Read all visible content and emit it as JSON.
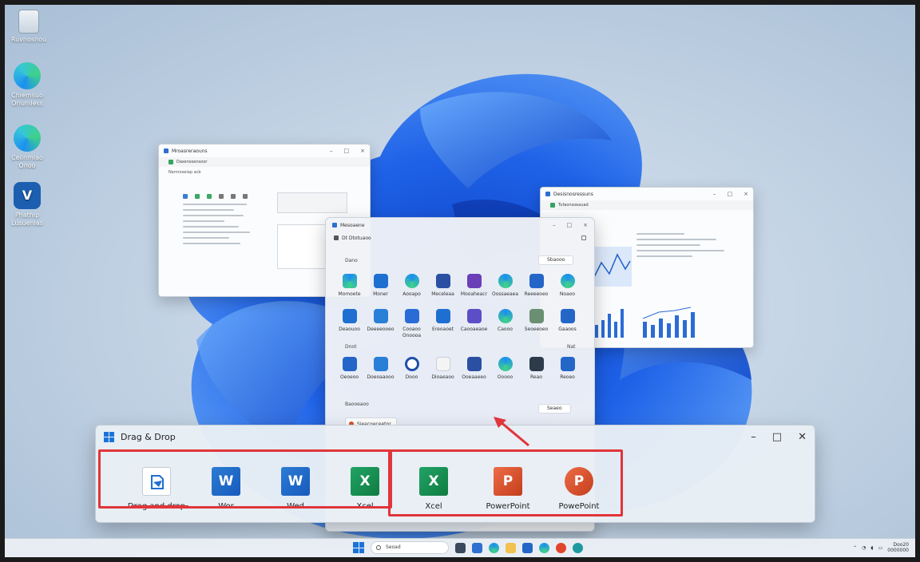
{
  "desktop": {
    "icons": [
      {
        "label": "Ruvnosnou",
        "icon": "recycle-bin-icon"
      },
      {
        "label": "Chiemsuo Oriuniless",
        "icon": "edge-icon"
      },
      {
        "label": "Ceiinmiao Onoo",
        "icon": "edge-icon"
      },
      {
        "label": "Phathip Lusuenias",
        "icon": "app-icon"
      }
    ]
  },
  "window_left": {
    "title": "Mroasreraouns",
    "address": "Dasensoensoor",
    "subtitle": "Nemroseiap acb"
  },
  "window_right": {
    "title": "Desisnosressuns",
    "address": "Tufaonsoeauad"
  },
  "start_menu": {
    "title": "Mesoaene",
    "search": "Dt Dtotuaoo",
    "pinned_label": "Dano",
    "all_button": "Sbaooo",
    "row1": [
      "Momoete",
      "Moner",
      "Aooapo",
      "Meceleaa",
      "Mooaheacr",
      "Oossaeaea",
      "Reeeeoeo",
      "Noaoo"
    ],
    "row2": [
      "Deaouoo",
      "Deeeeooeo",
      "Cooaoo Onoooa",
      "Ereoaoet",
      "Caooaeaoe",
      "Caooo",
      "Seoeeoeo",
      "Gaaoos"
    ],
    "section2_label": "Dnot",
    "section2_right": "Nat",
    "row3": [
      "Oeoeoo",
      "Doeoaaooo",
      "Dooo",
      "Dioaeaoo",
      "Ooeaaeeo",
      "Ooooo",
      "Reao",
      "Reoeo"
    ],
    "recommended_label": "Baooeaoo",
    "more_button": "Seaeo",
    "recommended_item": "Sieacoeceetor"
  },
  "drag_drop": {
    "title": "Drag & Drop",
    "items": [
      {
        "label": "Drag and drop",
        "icon": "drag-drop-icon"
      },
      {
        "label": "Wor",
        "icon": "word-icon",
        "letter": "W"
      },
      {
        "label": "Wed",
        "icon": "word-icon",
        "letter": "W"
      },
      {
        "label": "Xcel",
        "icon": "excel-icon",
        "letter": "X"
      },
      {
        "label": "Xcel",
        "icon": "excel-icon",
        "letter": "X"
      },
      {
        "label": "PowerPoint",
        "icon": "powerpoint-icon",
        "letter": "P"
      },
      {
        "label": "PowePoint",
        "icon": "powerpoint-icon",
        "letter": "P"
      }
    ],
    "highlight_color": "#e0353a"
  },
  "taskbar": {
    "search": "Seoad",
    "clock_time": "Doo20",
    "clock_date": "0000000"
  }
}
